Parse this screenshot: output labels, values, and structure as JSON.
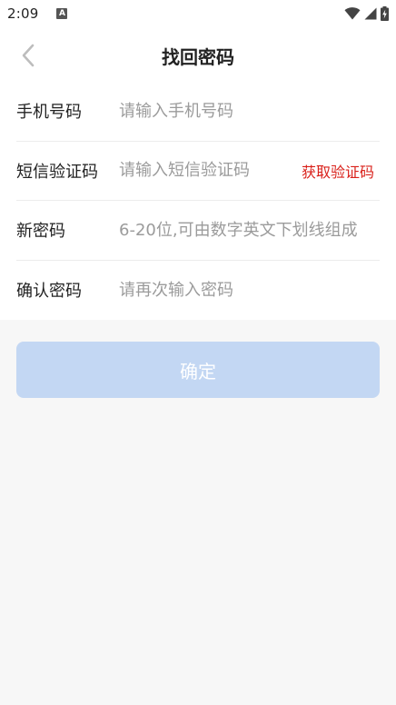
{
  "status_bar": {
    "time": "2:09",
    "notification_glyph": "A",
    "icons": [
      "wifi-icon",
      "signal-icon",
      "battery-charging-icon"
    ]
  },
  "header": {
    "back_icon": "chevron-left-icon",
    "title": "找回密码"
  },
  "form": {
    "phone": {
      "label": "手机号码",
      "placeholder": "请输入手机号码",
      "value": ""
    },
    "sms_code": {
      "label": "短信验证码",
      "placeholder": "请输入短信验证码",
      "value": "",
      "action_label": "获取验证码"
    },
    "new_password": {
      "label": "新密码",
      "placeholder": "6-20位,可由数字英文下划线组成",
      "value": ""
    },
    "confirm_password": {
      "label": "确认密码",
      "placeholder": "请再次输入密码",
      "value": ""
    }
  },
  "confirm_button": {
    "label": "确定"
  },
  "colors": {
    "accent_red": "#d9201a",
    "button_disabled_blue": "#c3d7f3",
    "page_background": "#f7f7f7",
    "placeholder_gray": "#9b9b9b"
  }
}
